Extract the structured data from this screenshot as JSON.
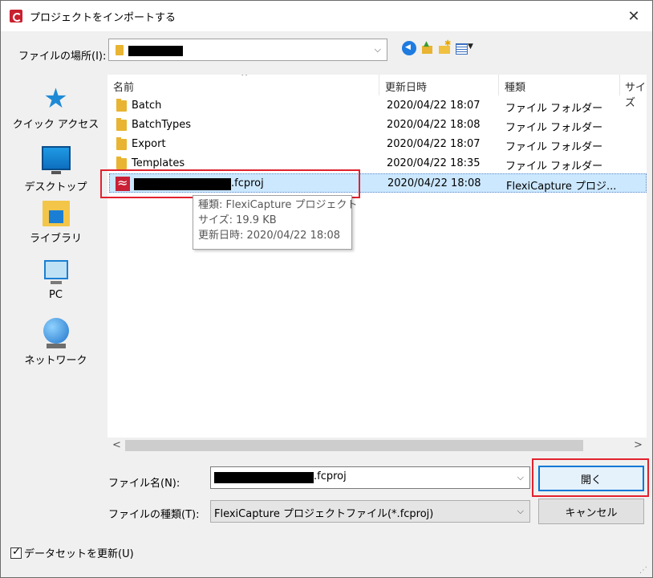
{
  "window": {
    "title": "プロジェクトをインポートする",
    "close": "✕"
  },
  "location": {
    "label": "ファイルの場所(I):",
    "arrow": "⌵"
  },
  "places": [
    {
      "label": "クイック アクセス",
      "icon": "quick-access-star-icon"
    },
    {
      "label": "デスクトップ",
      "icon": "desktop-icon"
    },
    {
      "label": "ライブラリ",
      "icon": "library-icon"
    },
    {
      "label": "PC",
      "icon": "pc-icon"
    },
    {
      "label": "ネットワーク",
      "icon": "network-icon"
    }
  ],
  "columns": {
    "name": "名前",
    "date": "更新日時",
    "type": "種類",
    "size": "サイズ",
    "sort_arrow": "^"
  },
  "rows": [
    {
      "name": "Batch",
      "date": "2020/04/22 18:07",
      "type": "ファイル フォルダー"
    },
    {
      "name": "BatchTypes",
      "date": "2020/04/22 18:08",
      "type": "ファイル フォルダー"
    },
    {
      "name": "Export",
      "date": "2020/04/22 18:07",
      "type": "ファイル フォルダー"
    },
    {
      "name": "Templates",
      "date": "2020/04/22 18:35",
      "type": "ファイル フォルダー"
    },
    {
      "name_suffix": ".fcproj",
      "date": "2020/04/22 18:08",
      "type": "FlexiCapture プロジ..."
    }
  ],
  "tooltip": {
    "type": "種類: FlexiCapture プロジェクト",
    "size": "サイズ: 19.9 KB",
    "modified": "更新日時: 2020/04/22 18:08"
  },
  "scroll": {
    "left": "<",
    "right": ">"
  },
  "filename": {
    "label": "ファイル名(N):",
    "suffix": ".fcproj",
    "arrow": "⌵"
  },
  "filetype": {
    "label": "ファイルの種類(T):",
    "value": "FlexiCapture プロジェクトファイル(*.fcproj)",
    "arrow": "⌵"
  },
  "buttons": {
    "open": "開く",
    "cancel": "キャンセル"
  },
  "checkbox": {
    "label": "データセットを更新(U)",
    "checked": true
  },
  "colors": {
    "highlight": "#e1222e",
    "selection": "#cce8ff",
    "accent": "#0078d7"
  }
}
